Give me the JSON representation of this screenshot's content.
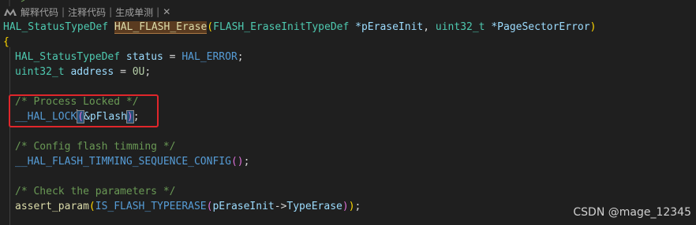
{
  "codelens": {
    "items": [
      "解释代码",
      "注释代码",
      "生成单测"
    ],
    "separator": "|",
    "close": "✕"
  },
  "code": {
    "sig_ret": "HAL_StatusTypeDef",
    "sig_fn": "HAL_FLASH_Erase",
    "sig_paren_open": "(",
    "sig_p1_type": "FLASH_EraseInitTypeDef",
    "sig_p1_name": " *pEraseInit",
    "sig_comma": ",",
    "sig_p2_type": " uint32_t",
    "sig_p2_name": " *PageSectorError",
    "sig_paren_close": ")",
    "brace_open": "{",
    "l1_type": "HAL_StatusTypeDef",
    "l1_var": " status",
    "l1_eq": " = ",
    "l1_val": "HAL_ERROR",
    "l1_semi": ";",
    "l2_type": "uint32_t",
    "l2_var": " address",
    "l2_eq": " = ",
    "l2_val": "0U",
    "l2_semi": ";",
    "c1": "/* Process Locked */",
    "lock_fn": "__HAL_LOCK",
    "lock_open": "(",
    "lock_arg": "&pFlash",
    "lock_close": ")",
    "lock_semi": ";",
    "c2": "/* Config flash timming */",
    "timing_fn": "__HAL_FLASH_TIMMING_SEQUENCE_CONFIG",
    "timing_parens": "()",
    "timing_semi": ";",
    "c3": "/* Check the parameters */",
    "assert_fn": "assert_param",
    "assert_open": "(",
    "is_fn": "IS_FLASH_TYPEERASE",
    "is_open": "(",
    "is_arg": "pEraseInit",
    "arrow": "->",
    "is_member": "TypeErase",
    "is_close": ")",
    "assert_close": ")",
    "assert_semi": ";"
  },
  "watermark": "CSDN @mage_12345"
}
